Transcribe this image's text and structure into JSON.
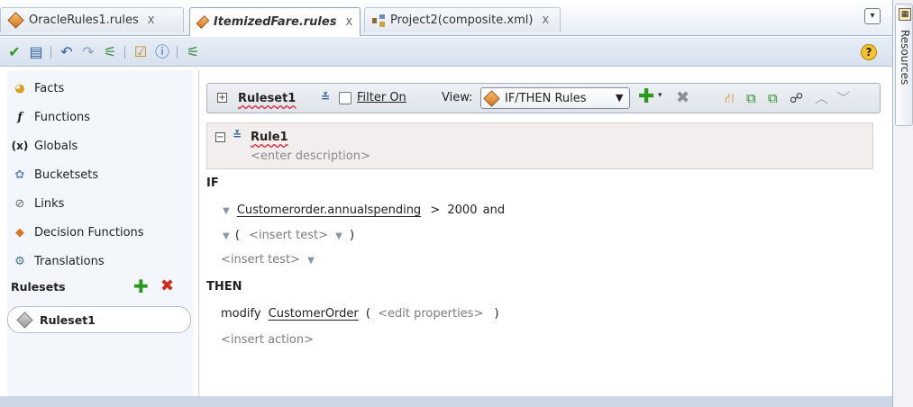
{
  "tabs": [
    {
      "label": "OracleRules1.rules",
      "close": "X"
    },
    {
      "label": "ItemizedFare.rules",
      "close": "X"
    },
    {
      "label": "Project2(composite.xml)",
      "close": "X"
    }
  ],
  "tabbar": {
    "dropdown_glyph": "▾"
  },
  "toolbar": {
    "validate_icon": "✔",
    "dictionary_icon": "▤",
    "undo_icon": "↶",
    "redo_icon": "↷",
    "diagram_icon": "⚟",
    "test_icon": "☑",
    "info_icon": "ⓘ",
    "compose_icon": "⚟",
    "help_label": "?"
  },
  "resources": {
    "label": "Resources"
  },
  "navigator": {
    "items": [
      {
        "label": "Facts",
        "icon": "facts-icon",
        "glyph": "◕",
        "color": "#d9a21c"
      },
      {
        "label": "Functions",
        "icon": "function-icon",
        "glyph": "f",
        "color": "#222222"
      },
      {
        "label": "Globals",
        "icon": "globals-icon",
        "glyph": "(x)",
        "color": "#222222"
      },
      {
        "label": "Bucketsets",
        "icon": "bucketsets-icon",
        "glyph": "✿",
        "color": "#6b8db8"
      },
      {
        "label": "Links",
        "icon": "links-icon",
        "glyph": "⊘",
        "color": "#5f6b79"
      },
      {
        "label": "Decision Functions",
        "icon": "decision-functions-icon",
        "glyph": "◆",
        "color": "#d47a26"
      },
      {
        "label": "Translations",
        "icon": "translations-icon",
        "glyph": "⚙",
        "color": "#4a6fa0"
      }
    ],
    "rulesets_header": "Rulesets",
    "rulesets_add": "✚",
    "rulesets_delete": "✖",
    "rulesets": [
      {
        "label": "Ruleset1"
      }
    ]
  },
  "editor": {
    "ruleset_name": "Ruleset1",
    "expand_glyph": "⊞",
    "collapse_glyph": "⊟",
    "chevron_glyph": "≚",
    "filter_label": "Filter On",
    "view_label": "View:",
    "view_value": "IF/THEN Rules",
    "add_glyph": "✚",
    "add_arrow": "▾",
    "delete_glyph": "✖",
    "tools": [
      {
        "name": "tree-icon",
        "glyph": "⛙",
        "color": "#d28a1c"
      },
      {
        "name": "copy-rule-icon",
        "glyph": "⧉",
        "color": "#2a8a2a"
      },
      {
        "name": "paste-rule-icon",
        "glyph": "⧉",
        "color": "#2a8a2a"
      },
      {
        "name": "advanced-mode-icon",
        "glyph": "☍",
        "color": "#333333"
      },
      {
        "name": "move-up-icon",
        "glyph": "︿",
        "color": "#9aa3ad"
      },
      {
        "name": "move-down-icon",
        "glyph": "﹀",
        "color": "#9aa3ad"
      }
    ],
    "rule": {
      "name": "Rule1",
      "description": "<enter description>"
    },
    "if_keyword": "IF",
    "then_keyword": "THEN",
    "condition": {
      "lhs": "Customerorder.annualspending",
      "operator": ">",
      "rhs": "2000",
      "connector": "and"
    },
    "nested": {
      "open": "(",
      "placeholder": "<insert test>",
      "close": ")"
    },
    "insert_test": "<insert test>",
    "action": {
      "verb": "modify",
      "target": "CustomerOrder",
      "open": "(",
      "properties": "<edit properties>",
      "close": ")"
    },
    "insert_action": "<insert action>"
  }
}
